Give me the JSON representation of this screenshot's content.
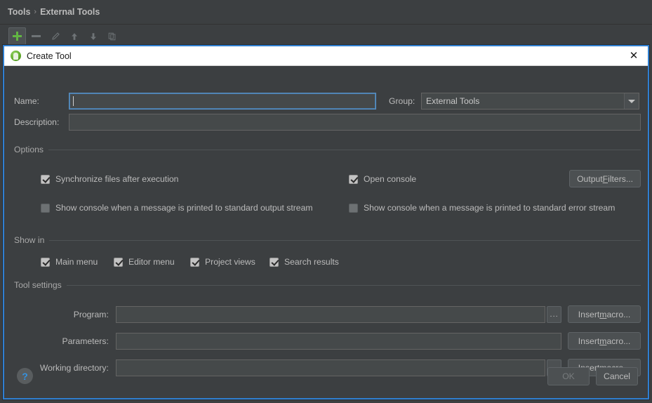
{
  "background": {
    "breadcrumb": {
      "root": "Tools",
      "separator": "›",
      "current": "External Tools"
    },
    "toolbar": [
      {
        "name": "add-button",
        "icon": "plus-icon",
        "label": "+",
        "state": "active"
      },
      {
        "name": "remove-button",
        "icon": "minus-icon",
        "label": "-",
        "state": "disabled"
      },
      {
        "name": "edit-button",
        "icon": "pencil-icon",
        "label": "Edit",
        "state": "disabled"
      },
      {
        "name": "move-up-button",
        "icon": "arrow-up-icon",
        "label": "Move Up",
        "state": "disabled"
      },
      {
        "name": "move-down-button",
        "icon": "arrow-down-icon",
        "label": "Move Down",
        "state": "disabled"
      },
      {
        "name": "copy-button",
        "icon": "copy-icon",
        "label": "Copy",
        "state": "disabled"
      }
    ]
  },
  "dialog": {
    "icon": "app-logo-icon",
    "title": "Create Tool",
    "close_label": "✕",
    "fields": {
      "name_label": "Name:",
      "name_value": "",
      "name_placeholder": "",
      "group_label": "Group:",
      "group_value": "External Tools",
      "group_options": [
        "External Tools"
      ],
      "description_label": "Description:",
      "description_value": "",
      "description_placeholder": ""
    },
    "options": {
      "title": "Options",
      "checkboxes": [
        {
          "label": "Synchronize files after execution",
          "checked": true
        },
        {
          "label": "Open console",
          "checked": true
        },
        {
          "label": "Show console when a message is printed to standard output stream",
          "checked": false
        },
        {
          "label": "Show console when a message is printed to standard error stream",
          "checked": false
        }
      ],
      "output_filters_button": {
        "pre": "Output ",
        "mnemonic": "F",
        "post": "ilters..."
      }
    },
    "show_in": {
      "title": "Show in",
      "checkboxes": [
        {
          "label": "Main menu",
          "checked": true
        },
        {
          "label": "Editor menu",
          "checked": true
        },
        {
          "label": "Project views",
          "checked": true
        },
        {
          "label": "Search results",
          "checked": true
        }
      ]
    },
    "tool_settings": {
      "title": "Tool settings",
      "rows": [
        {
          "label": "Program:",
          "value": "",
          "browse": true,
          "browse_label": "...",
          "macro": {
            "pre": "Insert ",
            "mnemonic": "m",
            "post": "acro..."
          }
        },
        {
          "label": "Parameters:",
          "value": "",
          "browse": false,
          "browse_label": "",
          "macro": {
            "pre": "Insert ",
            "mnemonic": "m",
            "post": "acro..."
          }
        },
        {
          "label": "Working directory:",
          "value": "",
          "browse": true,
          "browse_label": "...",
          "macro": {
            "pre": "Insert ",
            "mnemonic": "m",
            "post": "acro..."
          }
        }
      ]
    },
    "footer": {
      "help_label": "?",
      "ok_label": "OK",
      "cancel_label": "Cancel"
    }
  },
  "colors": {
    "window_bg": "#3c3f41",
    "dialog_border": "#2f7fd1",
    "titlebar_bg": "#ffffff",
    "accent_green": "#62b543",
    "help_blue": "#3592e0",
    "focus_blue": "#5890c4",
    "text": "#bbbbbb"
  }
}
